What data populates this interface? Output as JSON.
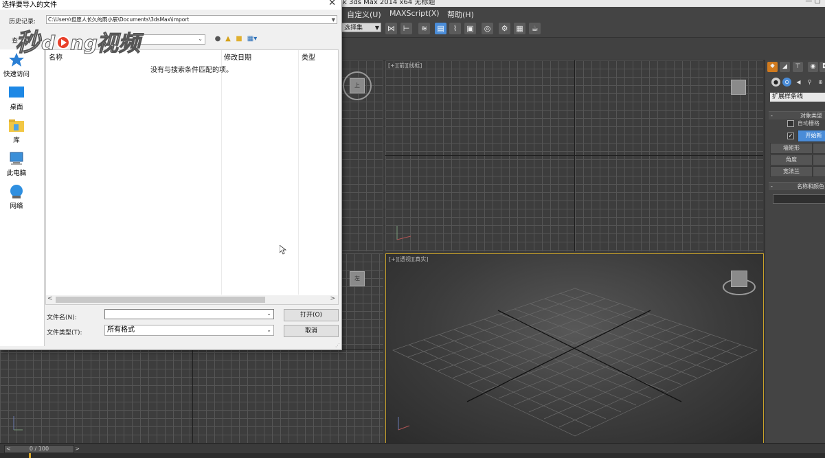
{
  "max": {
    "title": "k 3ds Max  2014 x64     无标题",
    "window_buttons": "— ▢",
    "menus": [
      "自定义(U)",
      "MAXScript(X)",
      "帮助(H)"
    ],
    "selection_set": "选择集",
    "viewports": {
      "top_right_label": "[+][前][线框]",
      "perspective_label": "[+][透视][真实]"
    },
    "viewcube_labels": {
      "left": "左",
      "topleft": "上"
    },
    "command_panel": {
      "dropdown": "扩展样条线",
      "rollout_object_type": "对象类型",
      "auto_grid": "自动栅格",
      "start_new_shape": "开始新",
      "buttons": [
        "墙矩形",
        "角度",
        "宽法兰"
      ],
      "rollout_name_color": "名称和颜色"
    },
    "time_slider": "0 / 100"
  },
  "dialog": {
    "title": "选择要导入的文件",
    "close": "✕",
    "history_label": "历史记录:",
    "history_path": "C:\\Users\\但愿人长久的雨小辰\\Documents\\3dsMax\\import",
    "lookin_label": "查",
    "places": [
      {
        "label": "快速访问",
        "icon": "star-icon"
      },
      {
        "label": "桌面",
        "icon": "desktop-icon"
      },
      {
        "label": "库",
        "icon": "library-folder-icon"
      },
      {
        "label": "此电脑",
        "icon": "computer-icon"
      },
      {
        "label": "网络",
        "icon": "network-icon"
      }
    ],
    "columns": {
      "name": "名称",
      "date": "修改日期",
      "type": "类型"
    },
    "empty_message": "没有与搜索条件匹配的项。",
    "filename_label": "文件名(N):",
    "filename_value": "",
    "filetype_label": "文件类型(T):",
    "filetype_value": "所有格式",
    "open_button": "打开(O)",
    "cancel_button": "取消"
  },
  "watermark": "秒dong视频",
  "colors": {
    "accent_blue": "#4a8cd8",
    "viewport_border": "#c9a22a",
    "tab_orange": "#d07a1e"
  }
}
